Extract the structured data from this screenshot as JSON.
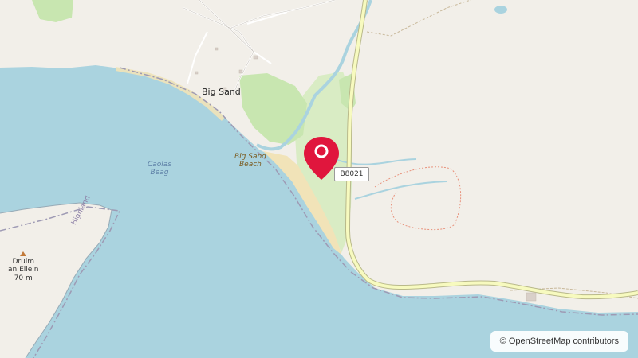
{
  "map": {
    "attribution": "© OpenStreetMap contributors",
    "colors": {
      "land": "#f2efe9",
      "water": "#aad3df",
      "forest": "#c8e6b0",
      "wetland": "#d9ecc4",
      "beach": "#f1e3b8",
      "road": "#f7fabf",
      "road_casing": "#b9b98a",
      "river": "#aad3df",
      "marker": "#e0163d"
    },
    "labels": {
      "village": "Big Sand",
      "beach_line1": "Big Sand",
      "beach_line2": "Beach",
      "bay_line1": "Caolas",
      "bay_line2": "Beag",
      "peak_line1": "Druim",
      "peak_line2": "an Eilein",
      "peak_line3": "70 m",
      "boundary": "Highland"
    },
    "road_ref": "B8021",
    "marker_icon": "map-pin-icon"
  }
}
